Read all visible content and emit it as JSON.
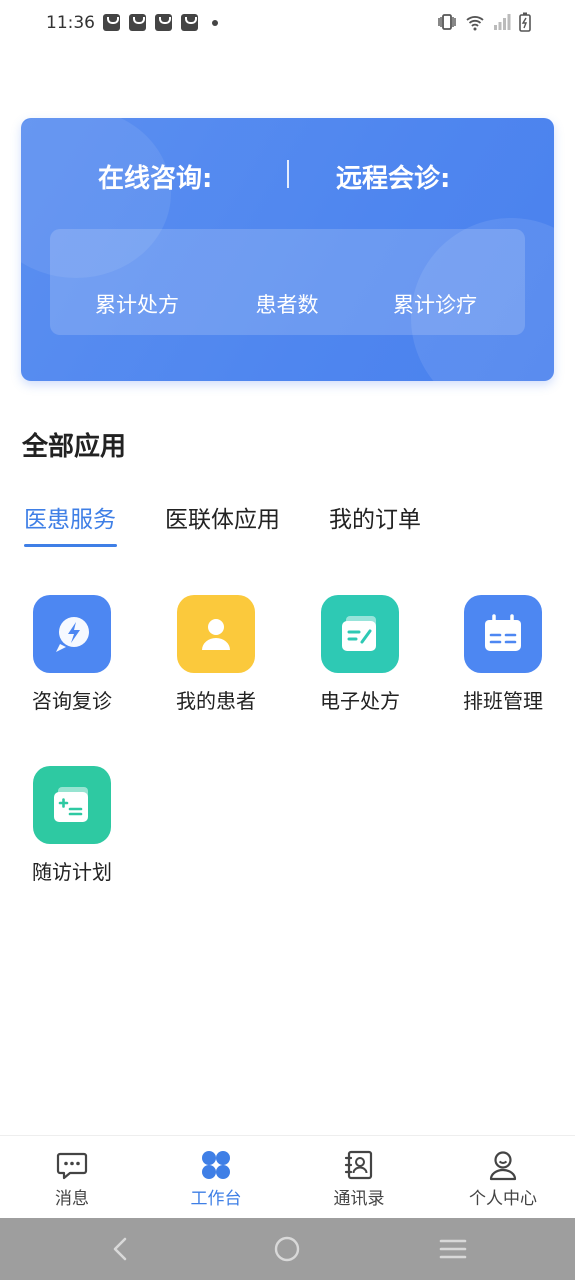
{
  "status_bar": {
    "time": "11:36"
  },
  "stats": {
    "online_consult_label": "在线咨询:",
    "remote_consult_label": "远程会诊:",
    "items": [
      {
        "label": "累计处方"
      },
      {
        "label": "患者数"
      },
      {
        "label": "累计诊疗"
      }
    ]
  },
  "section": {
    "title": "全部应用"
  },
  "tabs": [
    {
      "label": "医患服务",
      "active": true
    },
    {
      "label": "医联体应用",
      "active": false
    },
    {
      "label": "我的订单",
      "active": false
    }
  ],
  "apps": [
    {
      "label": "咨询复诊",
      "icon": "consult-icon",
      "color": "#4d87f2"
    },
    {
      "label": "我的患者",
      "icon": "patient-icon",
      "color": "#fbc93c"
    },
    {
      "label": "电子处方",
      "icon": "prescription-icon",
      "color": "#2ec9b4"
    },
    {
      "label": "排班管理",
      "icon": "schedule-icon",
      "color": "#4d87f2"
    },
    {
      "label": "随访计划",
      "icon": "followup-icon",
      "color": "#2ec9a2"
    }
  ],
  "bottom_nav": [
    {
      "label": "消息",
      "icon": "message-icon",
      "active": false
    },
    {
      "label": "工作台",
      "icon": "workbench-icon",
      "active": true
    },
    {
      "label": "通讯录",
      "icon": "contacts-icon",
      "active": false
    },
    {
      "label": "个人中心",
      "icon": "profile-icon",
      "active": false
    }
  ],
  "colors": {
    "primary": "#3f7fe6",
    "card": "#4f86ef"
  }
}
